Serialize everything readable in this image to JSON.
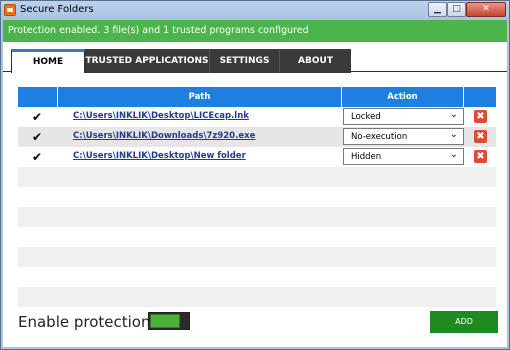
{
  "window": {
    "title": "Secure Folders",
    "controls": {
      "minimize": "▁",
      "maximize": "□",
      "close": "✕"
    }
  },
  "status": {
    "text": "Protection enabled. 3 file(s) and 1 trusted programs configured",
    "color": "#4bb44b"
  },
  "tabs": [
    {
      "label": "HOME",
      "active": true
    },
    {
      "label": "TRUSTED APPLICATIONS",
      "active": false
    },
    {
      "label": "SETTINGS",
      "active": false
    },
    {
      "label": "ABOUT",
      "active": false
    }
  ],
  "table": {
    "columns": {
      "path": "Path",
      "action": "Action"
    },
    "rows": [
      {
        "checked": true,
        "check_glyph": "✔",
        "path": "C:\\Users\\INKLIK\\Desktop\\LICEcap.lnk",
        "action": "Locked",
        "delete_glyph": "✖"
      },
      {
        "checked": true,
        "check_glyph": "✔",
        "path": "C:\\Users\\INKLIK\\Downloads\\7z920.exe",
        "action": "No-execution",
        "delete_glyph": "✖"
      },
      {
        "checked": true,
        "check_glyph": "✔",
        "path": "C:\\Users\\INKLIK\\Desktop\\New folder",
        "action": "Hidden",
        "delete_glyph": "✖"
      }
    ],
    "header_color": "#1e7fe0"
  },
  "footer": {
    "enable_label": "Enable protection:",
    "toggle_on": true,
    "add_label": "ADD",
    "accent": "#1f8a1f"
  },
  "icons": [
    "app-icon",
    "check-icon",
    "chevron-down-icon",
    "delete-icon"
  ]
}
